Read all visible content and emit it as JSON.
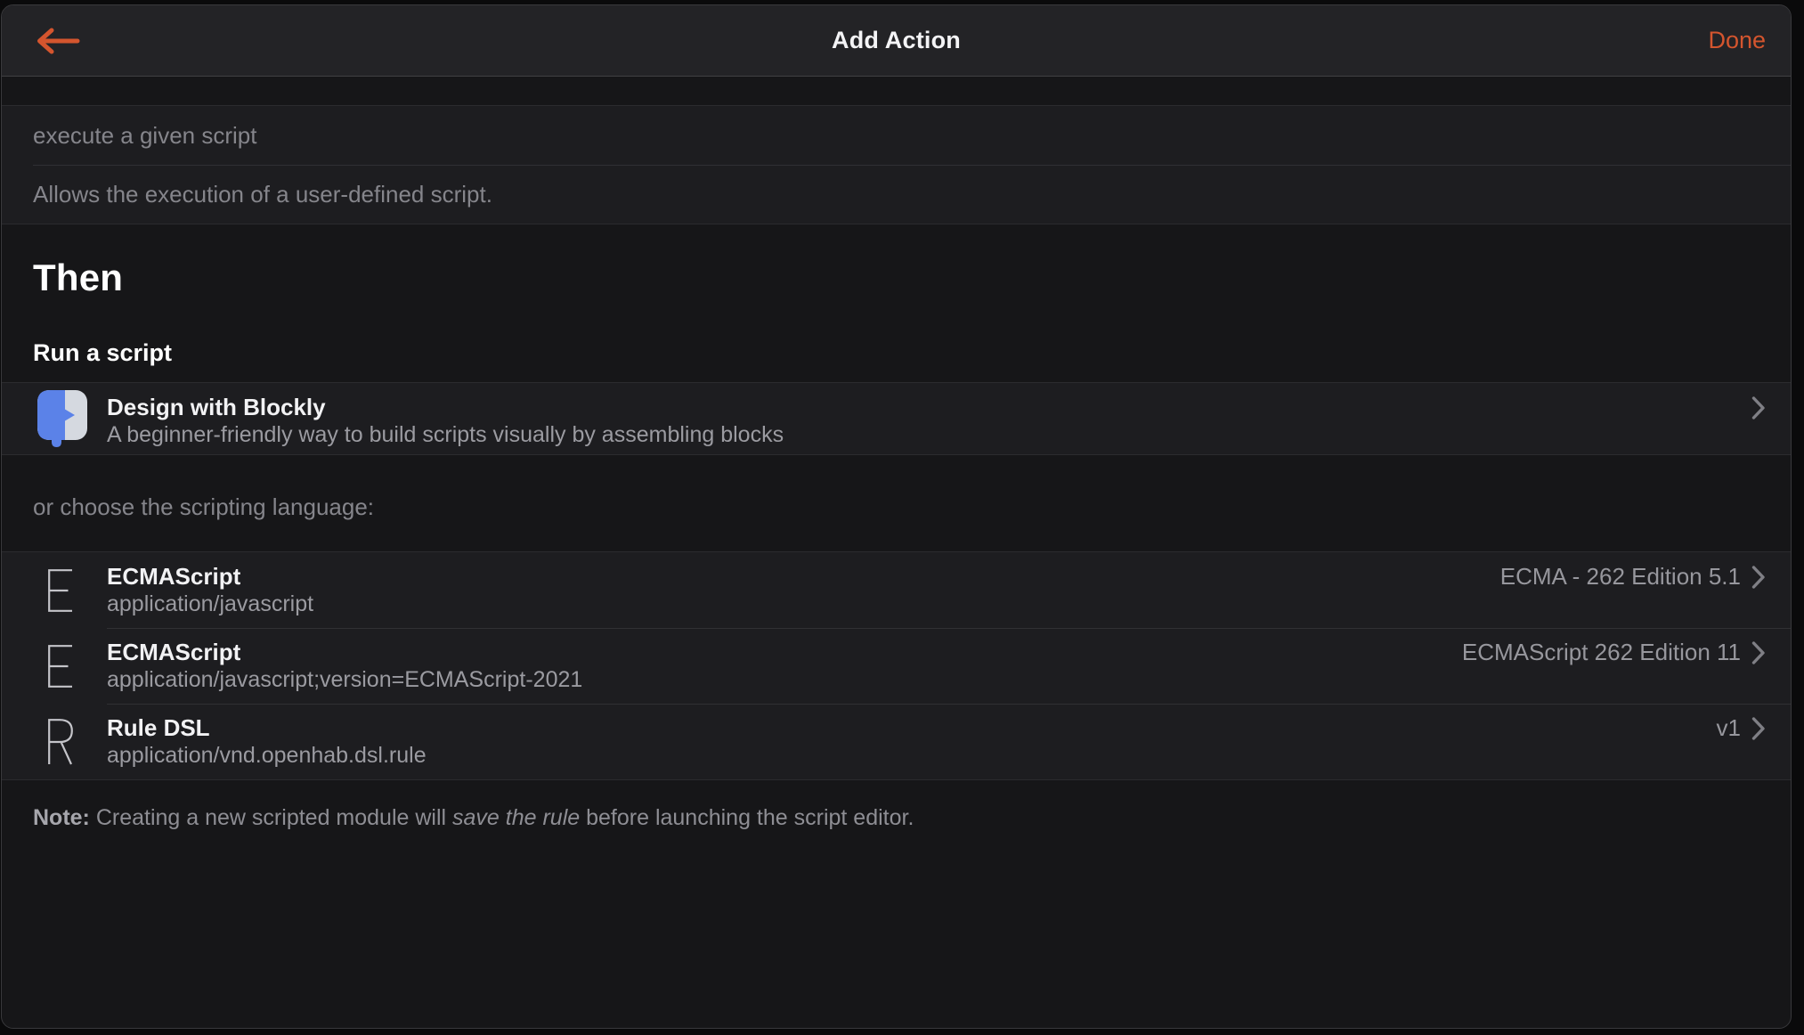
{
  "accent_color": "#d4552e",
  "navbar": {
    "title": "Add Action",
    "back_icon": "back-arrow-icon",
    "done_label": "Done"
  },
  "description_block": {
    "type_label": "execute a given script",
    "description": "Allows the execution of a user-defined script."
  },
  "section": {
    "title": "Then",
    "subtitle": "Run a script"
  },
  "blockly_item": {
    "icon": "blockly-icon",
    "icon_colors": {
      "blue": "#5b82e8",
      "gray": "#d5d9e0"
    },
    "title": "Design with Blockly",
    "subtitle": "A beginner-friendly way to build scripts visually by assembling blocks",
    "chevron_icon": "chevron-right-icon"
  },
  "choose_label": "or choose the scripting language:",
  "languages": [
    {
      "icon": "letter-e-icon",
      "icon_letter": "E",
      "title": "ECMAScript",
      "subtitle": "application/javascript",
      "version": "ECMA - 262 Edition 5.1",
      "chevron_icon": "chevron-right-icon"
    },
    {
      "icon": "letter-e-icon",
      "icon_letter": "E",
      "title": "ECMAScript",
      "subtitle": "application/javascript;version=ECMAScript-2021",
      "version": "ECMAScript 262 Edition 11",
      "chevron_icon": "chevron-right-icon"
    },
    {
      "icon": "letter-r-icon",
      "icon_letter": "R",
      "title": "Rule DSL",
      "subtitle": "application/vnd.openhab.dsl.rule",
      "version": "v1",
      "chevron_icon": "chevron-right-icon"
    }
  ],
  "note": {
    "prefix": "Note:",
    "before_italic": " Creating a new scripted module will ",
    "italic": "save the rule",
    "after_italic": " before launching the script editor."
  }
}
